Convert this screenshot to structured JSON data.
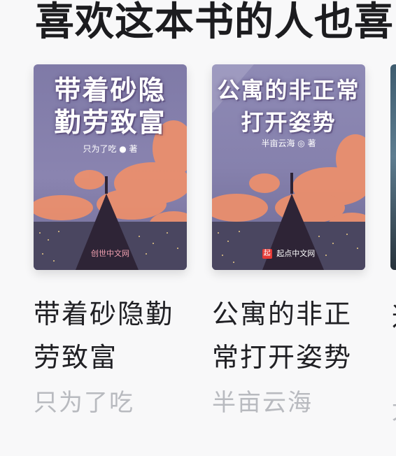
{
  "section": {
    "title": "喜欢这本书的人也喜"
  },
  "books": [
    {
      "cover_title": "带着砂隐\n勤劳致富",
      "cover_author": "只为了吃 ● 著",
      "cover_publisher": "创世中文网",
      "name": "带着砂隐勤劳致富",
      "author": "只为了吃"
    },
    {
      "cover_title": "公寓的非正常\n打开姿势",
      "cover_author": "半亩云海 ◎ 著",
      "cover_publisher": "起点中文网",
      "name": "公寓的非正常打开姿势",
      "author": "半亩云海"
    },
    {
      "name": "这",
      "author": "尤"
    }
  ],
  "colors": {
    "accent_logo": "#e53935",
    "title": "#1c1c1f",
    "author": "#b8babf"
  }
}
